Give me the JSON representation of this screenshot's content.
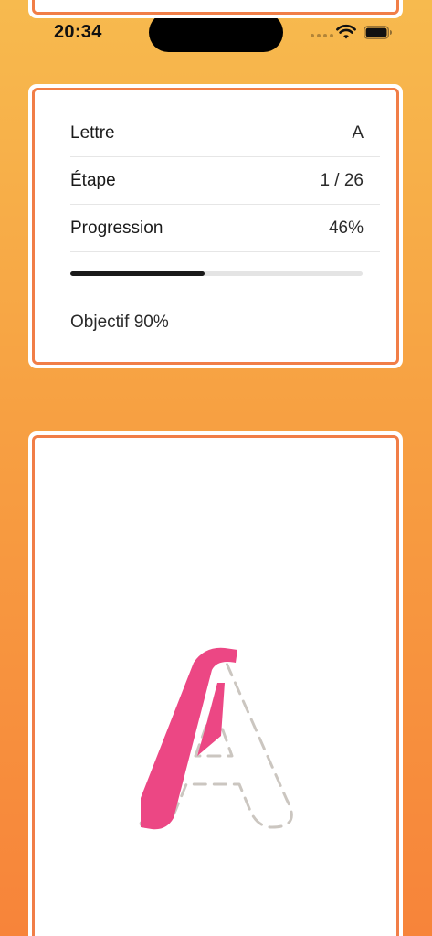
{
  "status_bar": {
    "time": "20:34",
    "icons": [
      "signal-dots-icon",
      "wifi-icon",
      "battery-icon"
    ]
  },
  "info_card": {
    "rows": [
      {
        "label": "Lettre",
        "value": "A"
      },
      {
        "label": "Étape",
        "value": "1 / 26"
      },
      {
        "label": "Progression",
        "value": "46%"
      }
    ],
    "progress_fraction": 0.46,
    "goal_text": "Objectif 90%"
  },
  "trace_card": {
    "letter": "A",
    "traced_color": "#EC4784",
    "guide_color": "#CBC6C0"
  },
  "colors": {
    "accent_border": "#F17E47",
    "background_top": "#F7BA4E",
    "background_bottom": "#F7843A",
    "progress_fill": "#1A1A1A"
  }
}
